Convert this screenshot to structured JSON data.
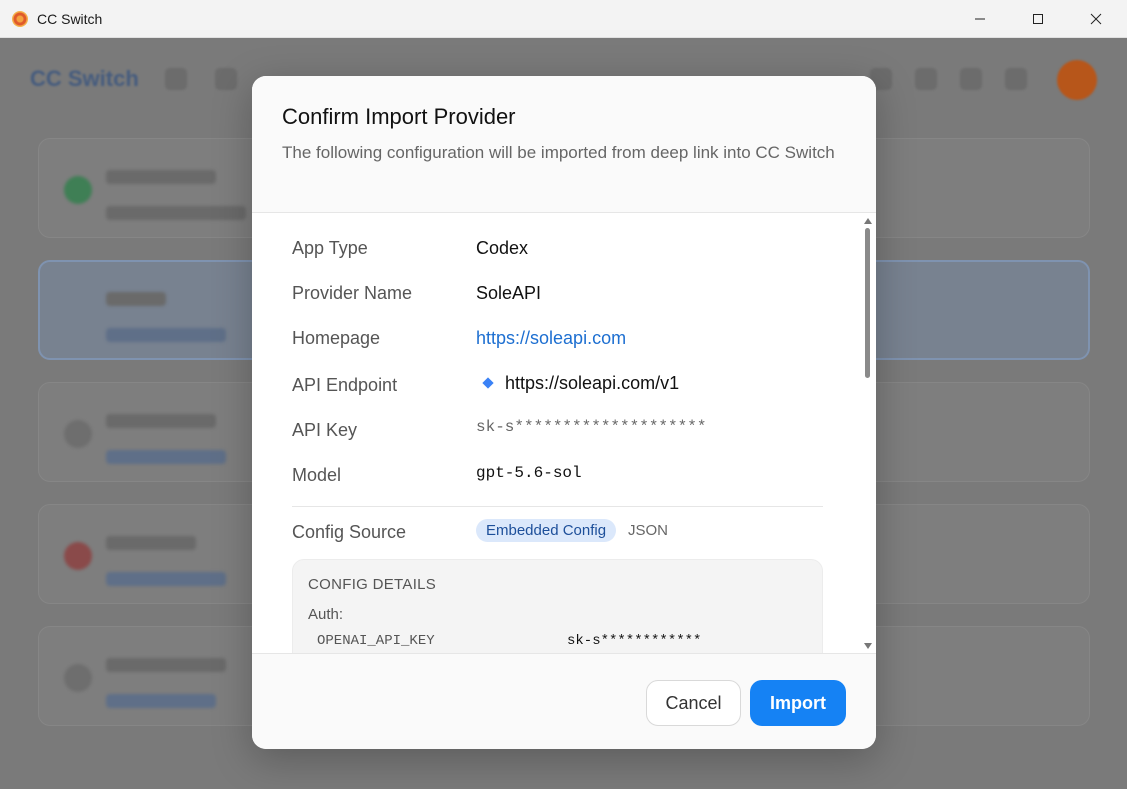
{
  "window": {
    "title": "CC Switch",
    "icon": "app-logo-icon"
  },
  "background_app": {
    "logo": "CC Switch"
  },
  "dialog": {
    "title": "Confirm Import Provider",
    "subtitle": "The following configuration will be imported from deep link into CC Switch",
    "fields": {
      "app_type": {
        "label": "App Type",
        "value": "Codex"
      },
      "provider_name": {
        "label": "Provider Name",
        "value": "SoleAPI"
      },
      "homepage": {
        "label": "Homepage",
        "value": "https://soleapi.com"
      },
      "api_endpoint": {
        "label": "API Endpoint",
        "value": "https://soleapi.com/v1"
      },
      "api_key": {
        "label": "API Key",
        "value": "sk-s********************"
      },
      "model": {
        "label": "Model",
        "value": "gpt-5.6-sol"
      }
    },
    "config_source": {
      "label": "Config Source",
      "badge": "Embedded Config",
      "format": "JSON"
    },
    "config_details": {
      "title": "CONFIG DETAILS",
      "section": "Auth:",
      "key": "OPENAI_API_KEY",
      "value": "sk-s************"
    },
    "buttons": {
      "cancel": "Cancel",
      "import": "Import"
    }
  },
  "colors": {
    "accent": "#1582f4",
    "link": "#1d6fd1",
    "badge_bg": "#dbe8fb"
  }
}
